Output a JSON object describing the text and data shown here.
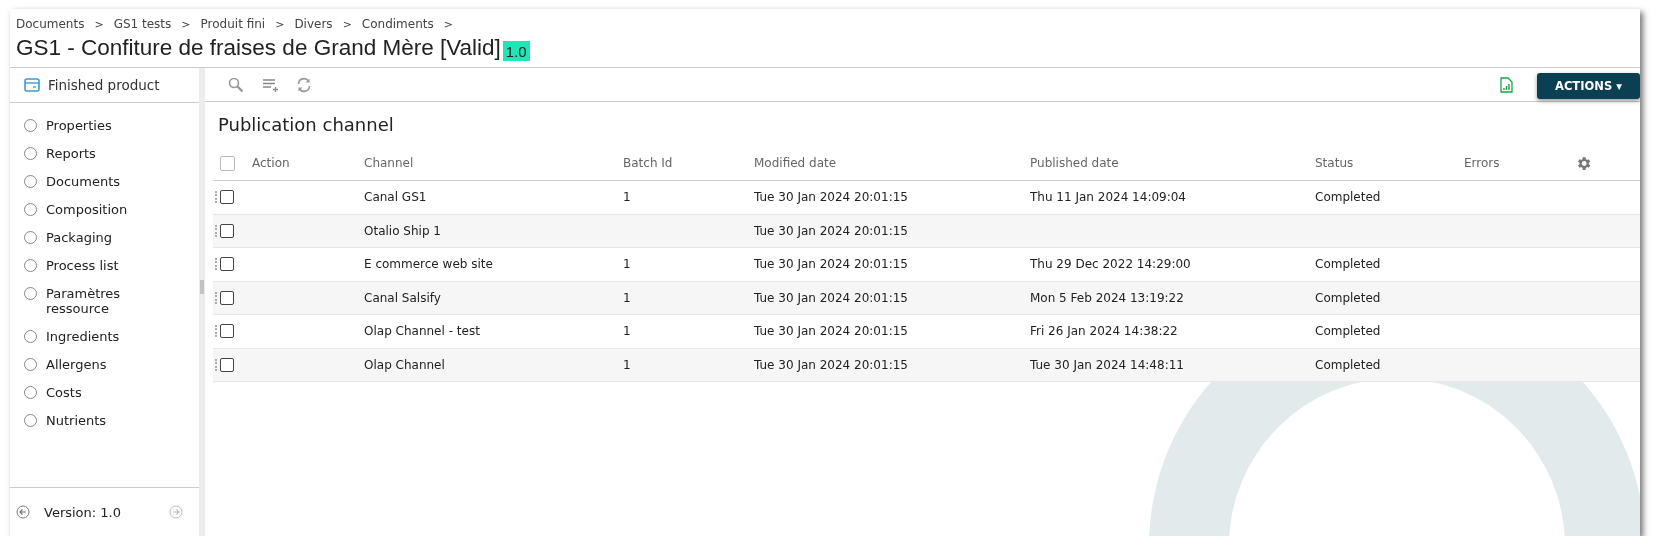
{
  "breadcrumb": {
    "separator": ">",
    "items": [
      "Documents",
      "GS1 tests",
      "Produit fini",
      "Divers",
      "Condiments"
    ]
  },
  "title": "GS1 - Confiture de fraises de Grand Mère [Valid]",
  "version_badge": "1.0",
  "sidebar": {
    "header": "Finished product",
    "items": [
      {
        "label": "Properties",
        "selected": false
      },
      {
        "label": "Reports",
        "selected": false
      },
      {
        "label": "Documents",
        "selected": false
      },
      {
        "label": "Composition",
        "selected": false
      },
      {
        "label": "Packaging",
        "selected": false
      },
      {
        "label": "Process list",
        "selected": false
      },
      {
        "label": "Paramètres ressource",
        "selected": false
      },
      {
        "label": "Ingredients",
        "selected": false
      },
      {
        "label": "Allergens",
        "selected": false
      },
      {
        "label": "Costs",
        "selected": false
      },
      {
        "label": "Nutrients",
        "selected": false
      }
    ],
    "footer": "Version: 1.0"
  },
  "actions_button": {
    "label": "ACTIONS",
    "caret": "▾"
  },
  "table": {
    "title": "Publication channel",
    "select_all_checked": false,
    "columns": [
      "Action",
      "Channel",
      "Batch Id",
      "Modified date",
      "Published date",
      "Status",
      "Errors"
    ],
    "rows": [
      {
        "checked": false,
        "cells": [
          "",
          "Canal GS1",
          "1",
          "Tue 30 Jan 2024 20:01:15",
          "Thu 11 Jan 2024 14:09:04",
          "Completed",
          ""
        ]
      },
      {
        "checked": false,
        "cells": [
          "",
          "Otalio Ship 1",
          "",
          "Tue 30 Jan 2024 20:01:15",
          "",
          "",
          ""
        ]
      },
      {
        "checked": false,
        "cells": [
          "",
          "E commerce web site",
          "1",
          "Tue 30 Jan 2024 20:01:15",
          "Thu 29 Dec 2022 14:29:00",
          "Completed",
          ""
        ]
      },
      {
        "checked": false,
        "cells": [
          "",
          "Canal Salsify",
          "1",
          "Tue 30 Jan 2024 20:01:15",
          "Mon 5 Feb 2024 13:19:22",
          "Completed",
          ""
        ]
      },
      {
        "checked": false,
        "cells": [
          "",
          "Olap Channel - test",
          "1",
          "Tue 30 Jan 2024 20:01:15",
          "Fri 26 Jan 2024 14:38:22",
          "Completed",
          ""
        ]
      },
      {
        "checked": false,
        "cells": [
          "",
          "Olap Channel",
          "1",
          "Tue 30 Jan 2024 20:01:15",
          "Tue 30 Jan 2024 14:48:11",
          "Completed",
          ""
        ]
      }
    ]
  }
}
